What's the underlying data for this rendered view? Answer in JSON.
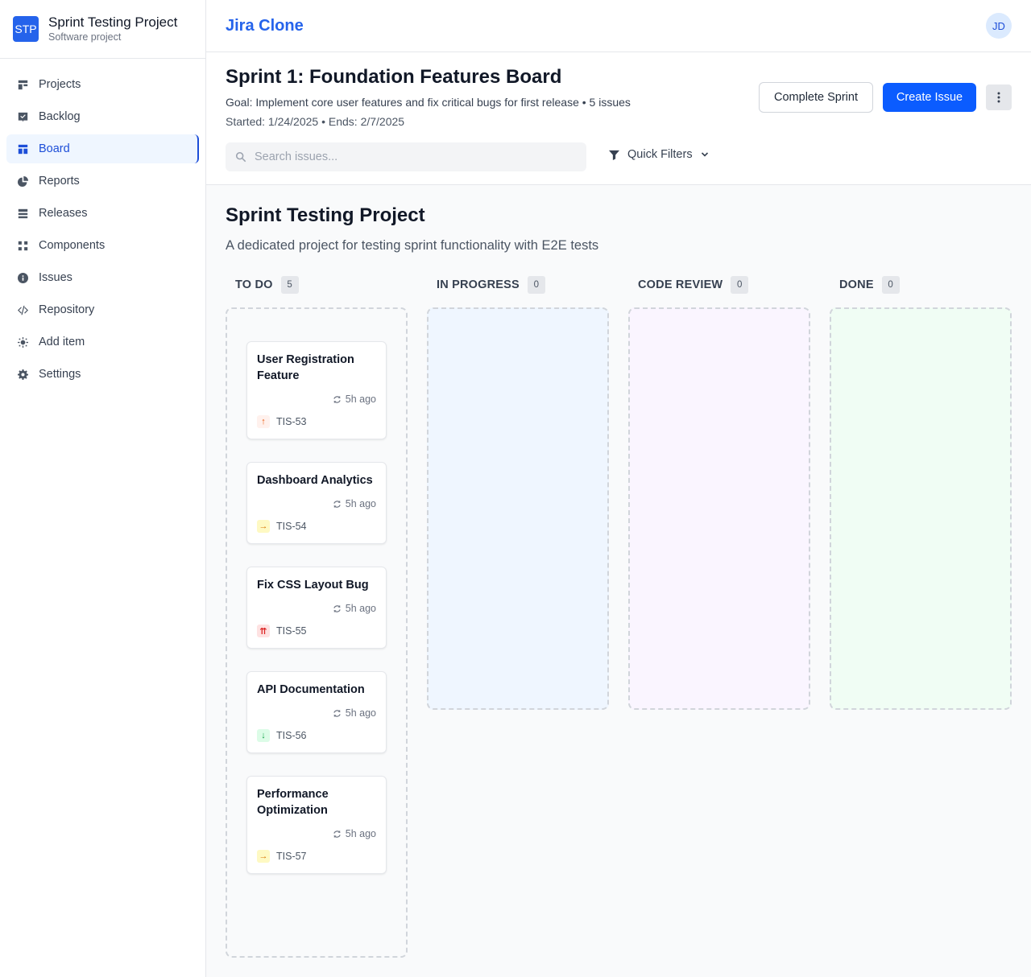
{
  "sidebar": {
    "project_badge": "STP",
    "project_name": "Sprint Testing Project",
    "project_type": "Software project",
    "items": [
      {
        "label": "Projects",
        "icon": "projects-icon"
      },
      {
        "label": "Backlog",
        "icon": "backlog-icon"
      },
      {
        "label": "Board",
        "icon": "board-icon",
        "active": true
      },
      {
        "label": "Reports",
        "icon": "reports-icon"
      },
      {
        "label": "Releases",
        "icon": "releases-icon"
      },
      {
        "label": "Components",
        "icon": "components-icon"
      },
      {
        "label": "Issues",
        "icon": "info-icon"
      },
      {
        "label": "Repository",
        "icon": "code-icon"
      },
      {
        "label": "Add item",
        "icon": "sun-icon"
      },
      {
        "label": "Settings",
        "icon": "gear-icon"
      }
    ]
  },
  "topbar": {
    "app_title": "Jira Clone",
    "avatar_initials": "JD"
  },
  "header": {
    "sprint_title": "Sprint 1: Foundation Features Board",
    "sprint_goal": "Goal: Implement core user features and fix critical bugs for first release • 5 issues",
    "sprint_dates": "Started: 1/24/2025 • Ends: 2/7/2025",
    "complete_sprint_label": "Complete Sprint",
    "create_issue_label": "Create Issue",
    "search_placeholder": "Search issues...",
    "quick_filters_label": "Quick Filters"
  },
  "board": {
    "project_title": "Sprint Testing Project",
    "project_description": "A dedicated project for testing sprint functionality with E2E tests",
    "columns": [
      {
        "title": "TO DO",
        "count": "5",
        "color": "#f9fafb",
        "cards": [
          {
            "title": "User Registration Feature",
            "time": "5h ago",
            "key": "TIS-53",
            "priority": "high",
            "priority_glyph": "↑"
          },
          {
            "title": "Dashboard Analytics",
            "time": "5h ago",
            "key": "TIS-54",
            "priority": "medium",
            "priority_glyph": "→"
          },
          {
            "title": "Fix CSS Layout Bug",
            "time": "5h ago",
            "key": "TIS-55",
            "priority": "highest",
            "priority_glyph": "⇈"
          },
          {
            "title": "API Documentation",
            "time": "5h ago",
            "key": "TIS-56",
            "priority": "low",
            "priority_glyph": "↓"
          },
          {
            "title": "Performance Optimization",
            "time": "5h ago",
            "key": "TIS-57",
            "priority": "medium",
            "priority_glyph": "→"
          }
        ]
      },
      {
        "title": "IN PROGRESS",
        "count": "0",
        "color": "#eff6ff",
        "cards": []
      },
      {
        "title": "CODE REVIEW",
        "count": "0",
        "color": "#faf5ff",
        "cards": []
      },
      {
        "title": "DONE",
        "count": "0",
        "color": "#f0fdf4",
        "cards": []
      }
    ]
  },
  "colors": {
    "accent": "#0b5cff",
    "brand": "#2563eb"
  }
}
